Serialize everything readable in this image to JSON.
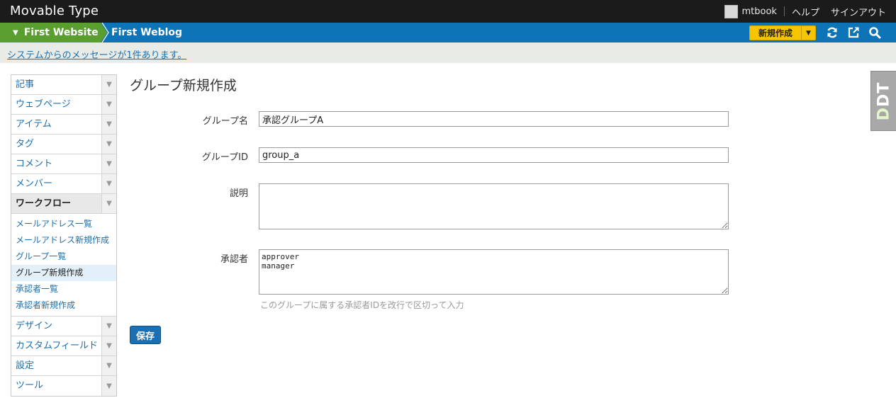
{
  "app": {
    "title": "Movable Type"
  },
  "user": {
    "name": "mtbook"
  },
  "topnav": {
    "help": "ヘルプ",
    "signout": "サインアウト"
  },
  "blogbar": {
    "website": "First Website",
    "blog": "First Weblog",
    "new_button": "新規作成"
  },
  "icons": {
    "refresh": "refresh-icon",
    "external": "external-link-icon",
    "search": "search-icon"
  },
  "message": {
    "text": "システムからのメッセージが1件あります。"
  },
  "sidebar": {
    "menu_top": [
      {
        "label": "記事"
      },
      {
        "label": "ウェブページ"
      },
      {
        "label": "アイテム"
      },
      {
        "label": "タグ"
      },
      {
        "label": "コメント"
      },
      {
        "label": "メンバー"
      }
    ],
    "workflow": {
      "label": "ワークフロー",
      "items": [
        {
          "label": "メールアドレス一覧"
        },
        {
          "label": "メールアドレス新規作成"
        },
        {
          "label": "グループ一覧"
        },
        {
          "label": "グループ新規作成"
        },
        {
          "label": "承認者一覧"
        },
        {
          "label": "承認者新規作成"
        }
      ]
    },
    "menu_bottom": [
      {
        "label": "デザイン"
      },
      {
        "label": "カスタムフィールド"
      },
      {
        "label": "設定"
      },
      {
        "label": "ツール"
      }
    ]
  },
  "form": {
    "title": "グループ新規作成",
    "group_name": {
      "label": "グループ名",
      "value": "承認グループA"
    },
    "group_id": {
      "label": "グループID",
      "value": "group_a"
    },
    "description": {
      "label": "説明",
      "value": ""
    },
    "approvers": {
      "label": "承認者",
      "value": "approver\nmanager",
      "hint": "このグループに属する承認者IDを改行で区切って入力"
    },
    "save_label": "保存"
  },
  "debug": {
    "label_d": "D",
    "label_rest": "DT"
  },
  "colors": {
    "topbar": "#1b1b1b",
    "blogbar": "#0d74b8",
    "website": "#5a9e30",
    "new_button": "#f6c400",
    "link": "#1a6fb0"
  }
}
